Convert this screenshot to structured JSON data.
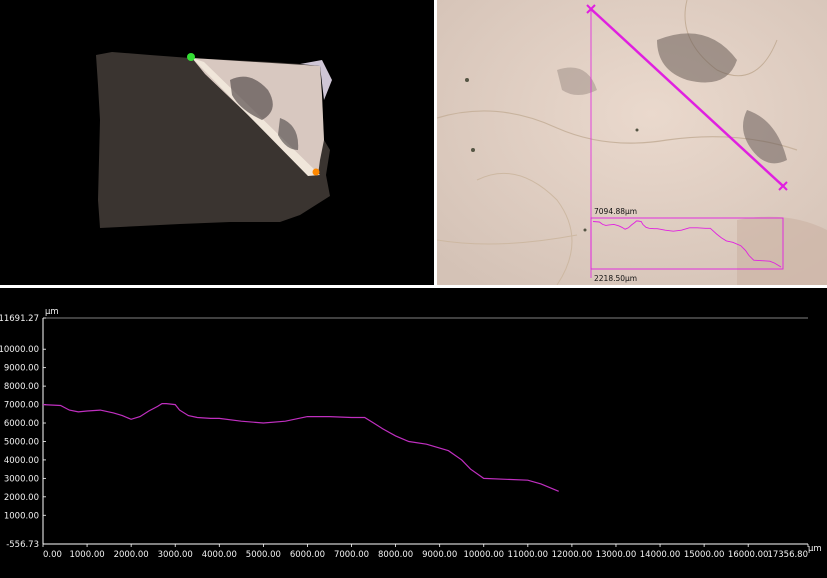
{
  "overlay": {
    "top_measure": "7094.88μm",
    "bottom_measure": "2218.50μm"
  },
  "colors": {
    "profile_line": "#c02fc0",
    "measure_line": "#e020e0",
    "start_marker": "#33dd33",
    "end_marker": "#ff8800",
    "axis": "#ffffff"
  },
  "chart_data": {
    "type": "line",
    "title": "",
    "y_unit": "μm",
    "x_unit": "μm",
    "xlim": [
      0.0,
      17356.8
    ],
    "ylim": [
      -556.73,
      11691.27
    ],
    "x_ticks": [
      "0.00",
      "1000.00",
      "2000.00",
      "3000.00",
      "4000.00",
      "5000.00",
      "6000.00",
      "7000.00",
      "8000.00",
      "9000.00",
      "10000.00",
      "11000.00",
      "12000.00",
      "13000.00",
      "14000.00",
      "15000.00",
      "16000.00",
      "17356.80"
    ],
    "y_ticks": [
      "11691.27",
      "10000.00",
      "9000.00",
      "8000.00",
      "7000.00",
      "6000.00",
      "5000.00",
      "4000.00",
      "3000.00",
      "2000.00",
      "1000.00",
      "-556.73"
    ],
    "x": [
      0,
      400,
      600,
      800,
      1000,
      1300,
      1600,
      1800,
      2000,
      2200,
      2400,
      2600,
      2700,
      2800,
      3000,
      3100,
      3300,
      3500,
      3800,
      4000,
      4500,
      5000,
      5500,
      6000,
      6500,
      7000,
      7300,
      7500,
      7700,
      8000,
      8300,
      8700,
      9200,
      9500,
      9700,
      10000,
      10500,
      11000,
      11300,
      11700
    ],
    "values": [
      7000,
      6950,
      6700,
      6600,
      6650,
      6700,
      6550,
      6400,
      6200,
      6350,
      6650,
      6900,
      7050,
      7050,
      7000,
      6700,
      6400,
      6300,
      6250,
      6250,
      6100,
      6000,
      6100,
      6350,
      6350,
      6300,
      6300,
      6000,
      5700,
      5300,
      5000,
      4850,
      4500,
      4000,
      3500,
      3000,
      2950,
      2900,
      2700,
      2300
    ]
  }
}
